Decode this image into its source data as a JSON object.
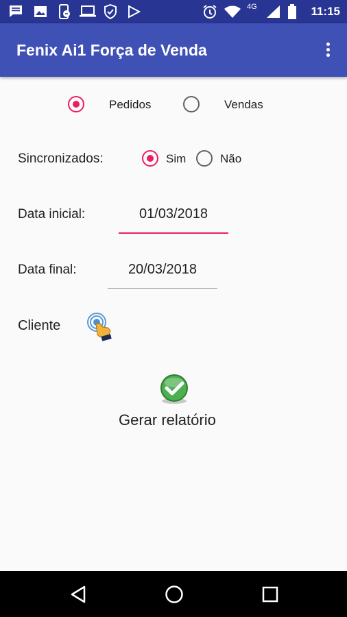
{
  "status_bar": {
    "time": "11:15",
    "network": "4G",
    "icons": [
      "message-icon",
      "image-icon",
      "phone-sync-icon",
      "laptop-icon",
      "shield-icon",
      "play-store-icon",
      "alarm-icon",
      "wifi-icon",
      "signal-icon",
      "battery-icon"
    ]
  },
  "app_bar": {
    "title": "Fenix Ai1 Força de Venda",
    "menu_icon": "overflow-menu-icon"
  },
  "report_type": {
    "options": [
      {
        "label": "Pedidos",
        "selected": true
      },
      {
        "label": "Vendas",
        "selected": false
      }
    ]
  },
  "sincronizados": {
    "label": "Sincronizados:",
    "options": [
      {
        "label": "Sim",
        "selected": true
      },
      {
        "label": "Não",
        "selected": false
      }
    ]
  },
  "data_inicial": {
    "label": "Data inicial:",
    "value": "01/03/2018",
    "focused": true
  },
  "data_final": {
    "label": "Data final:",
    "value": "20/03/2018"
  },
  "cliente": {
    "label": "Cliente",
    "icon": "touch-select-icon"
  },
  "action": {
    "label": "Gerar relatório",
    "icon": "green-check-icon"
  },
  "colors": {
    "primary": "#3f51b5",
    "primary_dark": "#283593",
    "accent": "#e91e63"
  },
  "nav_bar": {
    "icons": [
      "back-icon",
      "home-icon",
      "recents-icon"
    ]
  }
}
